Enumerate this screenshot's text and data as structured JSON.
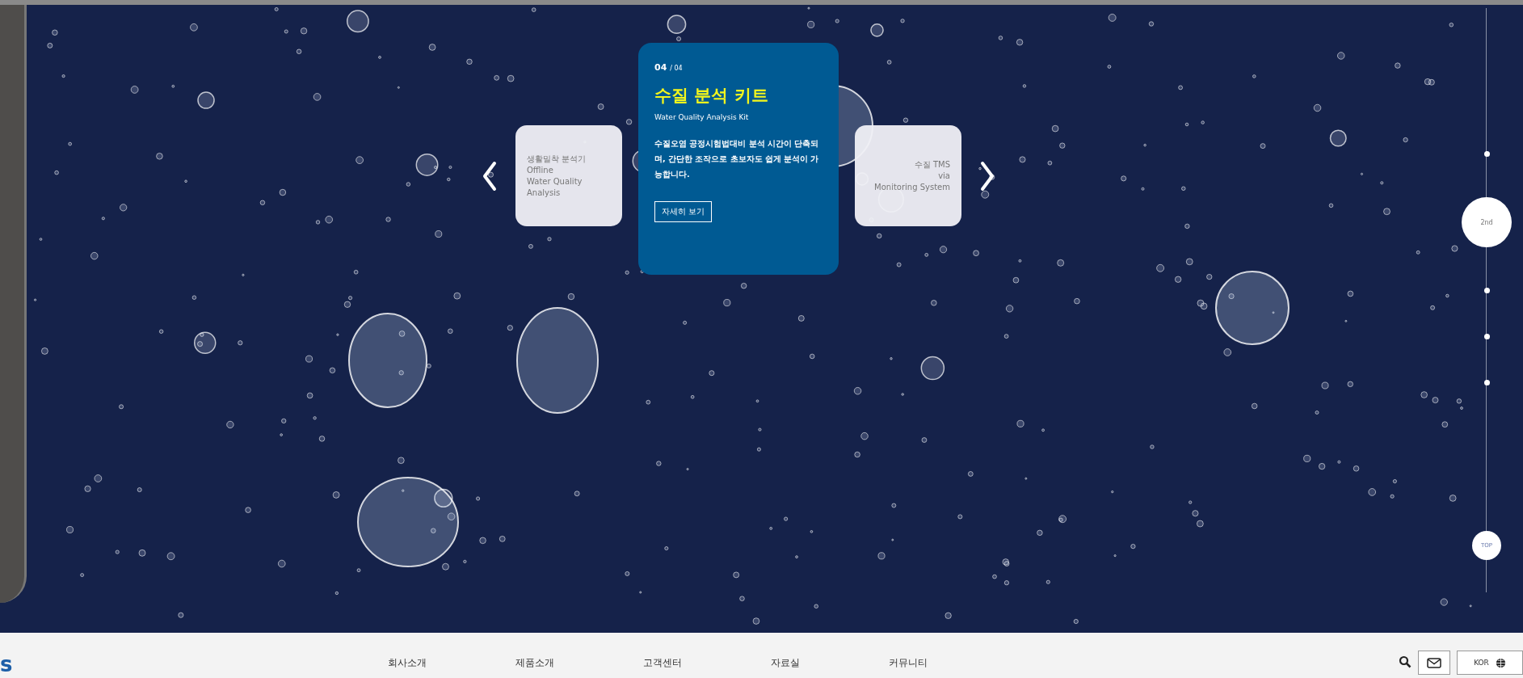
{
  "slides": [
    {
      "kind": "side",
      "selected": false,
      "title": "생활밀착 분석기",
      "lines": [
        "Offline",
        "Water Quality Analysis"
      ]
    },
    {
      "kind": "main",
      "selected": true,
      "counter_current": "04",
      "counter_total": "/ 04",
      "title": "수질 분석 키트",
      "subtitle": "Water Quality Analysis Kit",
      "description": "수질오염 공정시험법대비 분석 시간이 단축되며, 간단한 조작으로 초보자도 쉽게 분석이 가능합니다.",
      "button": "자세히 보기"
    },
    {
      "kind": "side",
      "selected": false,
      "title": "수질 TMS",
      "lines": [
        "via",
        "Monitoring System"
      ]
    }
  ],
  "page_indicator": [
    {
      "selected": false
    },
    {
      "selected": true,
      "label": "2nd"
    },
    {
      "selected": false
    },
    {
      "selected": false
    },
    {
      "selected": false
    }
  ],
  "top_button": "TOP",
  "header": {
    "logo_text": "s",
    "menu": [
      "회사소개",
      "제품소개",
      "고객센터",
      "자료실",
      "커뮤니티"
    ],
    "language": "KOR"
  }
}
